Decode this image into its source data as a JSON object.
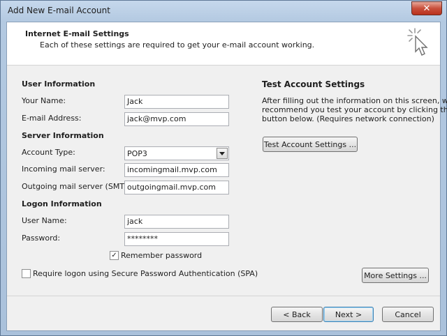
{
  "window": {
    "title": "Add New E-mail Account",
    "close_label": "✕"
  },
  "header": {
    "title": "Internet E-mail Settings",
    "subtitle": "Each of these settings are required to get your e-mail account working."
  },
  "user_info": {
    "section": "User Information",
    "name_label": "Your Name:",
    "name_value": "Jack",
    "email_label": "E-mail Address:",
    "email_value": "jack@mvp.com"
  },
  "server_info": {
    "section": "Server Information",
    "account_type_label": "Account Type:",
    "account_type_value": "POP3",
    "incoming_label": "Incoming mail server:",
    "incoming_value": "incomingmail.mvp.com",
    "outgoing_label": "Outgoing mail server (SMTP):",
    "outgoing_value": "outgoingmail.mvp.com"
  },
  "logon_info": {
    "section": "Logon Information",
    "username_label": "User Name:",
    "username_value": "jack",
    "password_label": "Password:",
    "password_value": "********",
    "remember_label": "Remember password",
    "remember_checked": true,
    "spa_label": "Require logon using Secure Password Authentication (SPA)",
    "spa_checked": false
  },
  "test": {
    "section": "Test Account Settings",
    "description_line1": "After filling out the information on this screen, we",
    "description_line2": "recommend you test your account by clicking the",
    "description_line3": "button below. (Requires network connection)",
    "button_label": "Test Account Settings ..."
  },
  "buttons": {
    "more_settings": "More Settings ...",
    "back": "< Back",
    "next": "Next >",
    "cancel": "Cancel"
  },
  "icons": {
    "header": "cursor-click-icon",
    "dropdown": "chevron-down-icon",
    "check": "✓"
  }
}
